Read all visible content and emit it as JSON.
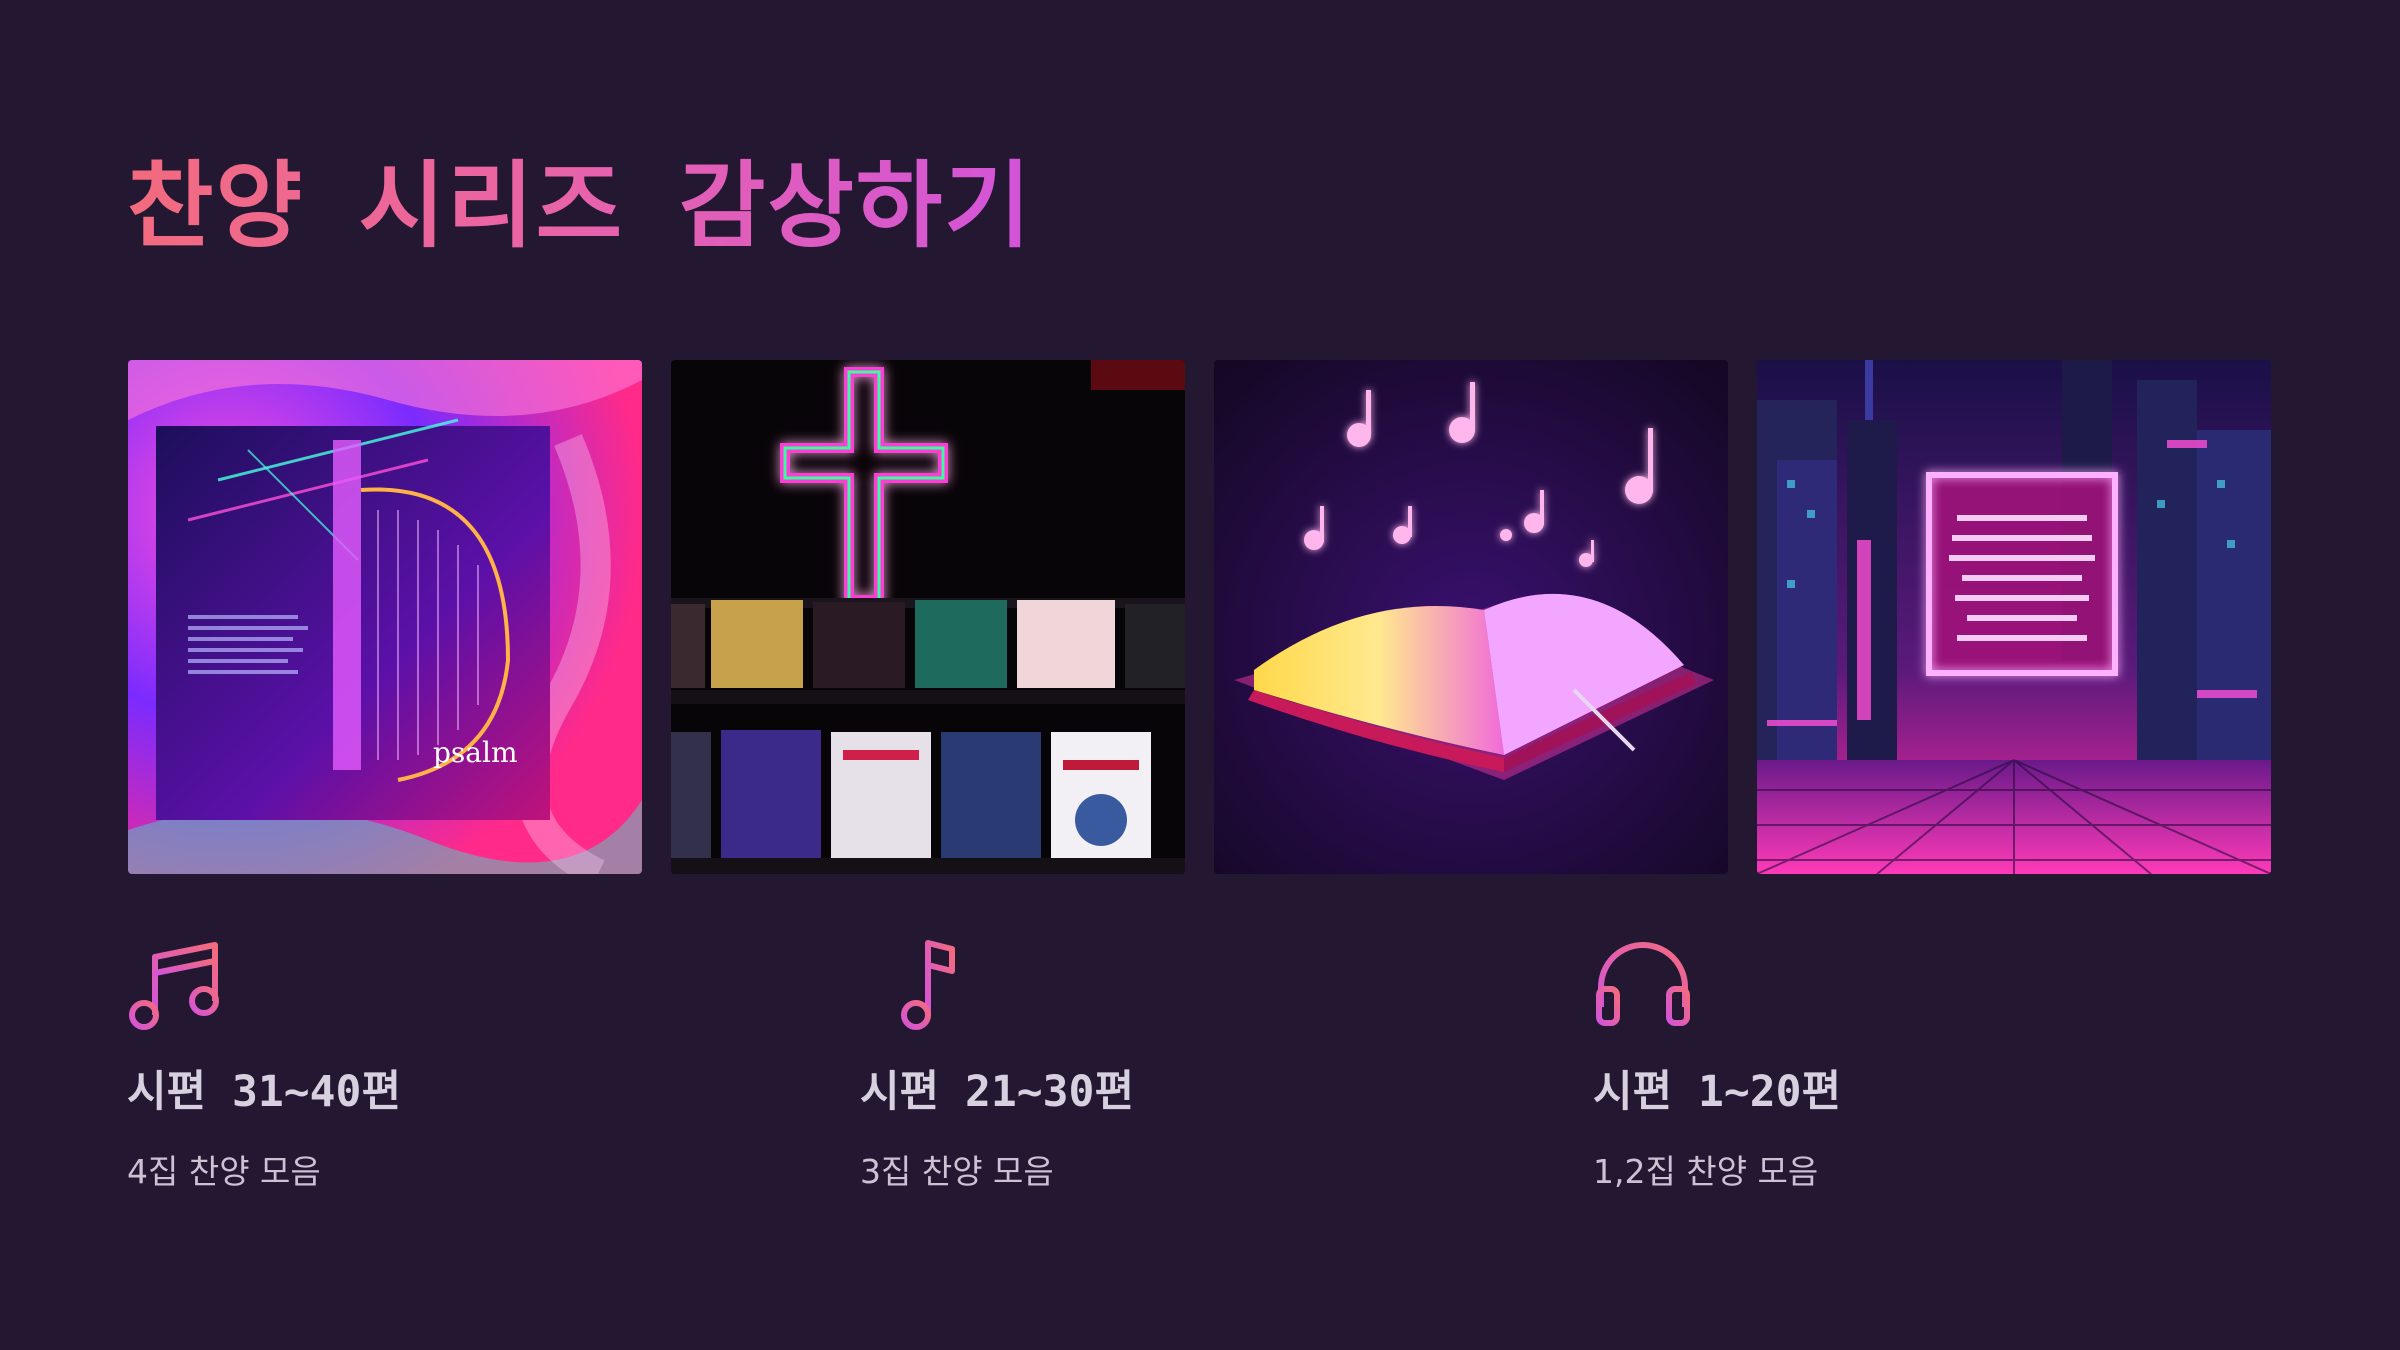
{
  "page": {
    "title": "찬양 시리즈 감상하기",
    "accent_gradient": [
      "#f36b7e",
      "#e964a6",
      "#d354d9"
    ],
    "background": "#231731"
  },
  "gallery": [
    {
      "name": "psalm-album-cover-image",
      "caption": "psalm"
    },
    {
      "name": "neon-cross-cd-rack-image",
      "caption": ""
    },
    {
      "name": "open-bible-music-notes-image",
      "caption": ""
    },
    {
      "name": "neon-city-billboard-image",
      "caption": ""
    }
  ],
  "features": [
    {
      "icon": "music-notes-icon",
      "title": "시편 31~40편",
      "subtitle": "4집 찬양 모음"
    },
    {
      "icon": "playlist-icon",
      "title": "시편 21~30편",
      "subtitle": "3집 찬양 모음"
    },
    {
      "icon": "headphones-icon",
      "title": "시편 1~20편",
      "subtitle": "1,2집 찬양 모음"
    }
  ]
}
